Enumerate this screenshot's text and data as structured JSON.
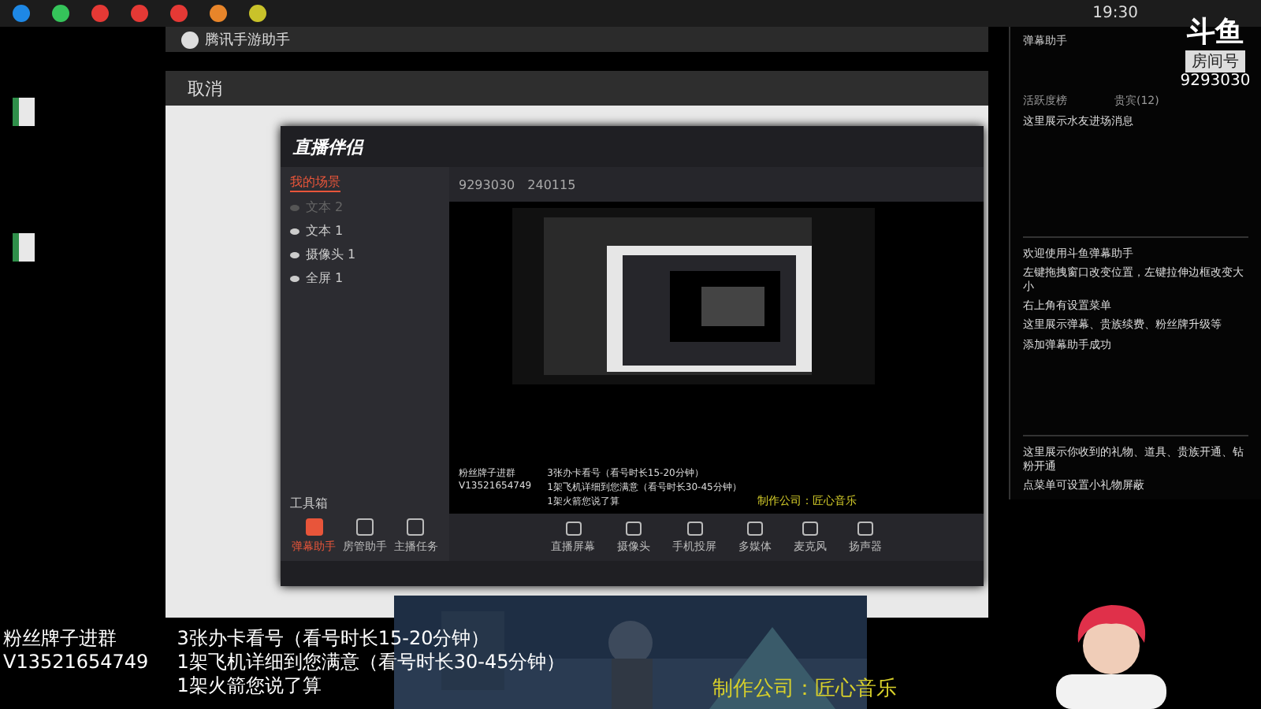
{
  "taskbar": {
    "clock": "19:30"
  },
  "game_window": {
    "title": "腾讯手游助手",
    "cancel": "取消"
  },
  "studio": {
    "app_name": "直播伴侣",
    "room_id": "9293030",
    "heat": "240115",
    "scene_tab": "我的场景",
    "layers": [
      {
        "label": "文本 2",
        "visible": false
      },
      {
        "label": "文本 1",
        "visible": true
      },
      {
        "label": "摄像头 1",
        "visible": true
      },
      {
        "label": "全屏 1",
        "visible": true
      }
    ],
    "toolbox_title": "工具箱",
    "tools": [
      {
        "label": "弹幕助手",
        "selected": true
      },
      {
        "label": "房管助手",
        "selected": false
      },
      {
        "label": "主播任务",
        "selected": false
      }
    ],
    "controls": [
      "直播屏幕",
      "摄像头",
      "手机投屏",
      "多媒体",
      "麦克风",
      "扬声器"
    ],
    "preview_overlay": {
      "left": [
        "粉丝牌子进群",
        "V13521654749"
      ],
      "right": [
        "3张办卡看号（看号时长15-20分钟）",
        "1架飞机详细到您满意（看号时长30-45分钟）",
        "1架火箭您说了算"
      ],
      "credit": "制作公司：匠心音乐"
    }
  },
  "danmu_panel": {
    "title": "弹幕助手",
    "tabs": [
      {
        "label": "活跃度榜",
        "selected": false
      },
      {
        "label": "贵宾(12)",
        "selected": false
      }
    ],
    "enter_hint": "这里展示水友进场消息",
    "welcome": [
      "欢迎使用斗鱼弹幕助手",
      "左键拖拽窗口改变位置，左键拉伸边框改变大小",
      "右上角有设置菜单",
      "这里展示弹幕、贵族续费、粉丝牌升级等",
      "添加弹幕助手成功"
    ],
    "gift_hint": [
      "这里展示你收到的礼物、道具、贵族开通、钻粉开通",
      "点菜单可设置小礼物屏蔽"
    ]
  },
  "logo": {
    "brand": "斗鱼",
    "room_label": "房间号",
    "room_id": "9293030"
  },
  "overlay": {
    "left": [
      "粉丝牌子进群",
      "V13521654749"
    ],
    "right": [
      "3张办卡看号（看号时长15-20分钟）",
      "1架飞机详细到您满意（看号时长30-45分钟）",
      "1架火箭您说了算"
    ],
    "credit": "制作公司：匠心音乐"
  }
}
